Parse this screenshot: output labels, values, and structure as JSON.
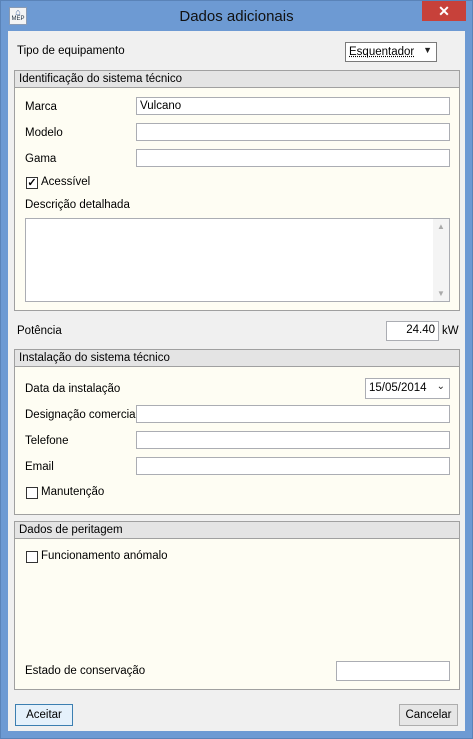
{
  "window": {
    "title": "Dados adicionais",
    "close_glyph": "✕",
    "icon": "mep-house-icon",
    "icon_text": "MEP"
  },
  "equipment": {
    "label": "Tipo de equipamento",
    "selected": "Esquentador"
  },
  "identificacao": {
    "header": "Identificação do sistema técnico",
    "marca_label": "Marca",
    "marca_value": "Vulcano",
    "modelo_label": "Modelo",
    "modelo_value": "",
    "gama_label": "Gama",
    "gama_value": "",
    "acessivel_label": "Acessível",
    "acessivel_checked": true,
    "descricao_label": "Descrição detalhada",
    "descricao_value": ""
  },
  "potencia": {
    "label": "Potência",
    "value": "24.40",
    "unit": "kW"
  },
  "instalacao": {
    "header": "Instalação do sistema técnico",
    "data_label": "Data da instalação",
    "data_value": "15/05/2014",
    "designacao_label": "Designação comercial",
    "designacao_value": "",
    "telefone_label": "Telefone",
    "telefone_value": "",
    "email_label": "Email",
    "email_value": "",
    "manutencao_label": "Manutenção",
    "manutencao_checked": false
  },
  "peritagem": {
    "header": "Dados de peritagem",
    "funcionamento_label": "Funcionamento anómalo",
    "funcionamento_checked": false,
    "estado_label": "Estado de conservação",
    "estado_value": ""
  },
  "buttons": {
    "accept": "Aceitar",
    "cancel": "Cancelar"
  },
  "colors": {
    "titlebar": "#6d9ad3",
    "close": "#c7413a",
    "group_bg": "#fefdf3"
  }
}
